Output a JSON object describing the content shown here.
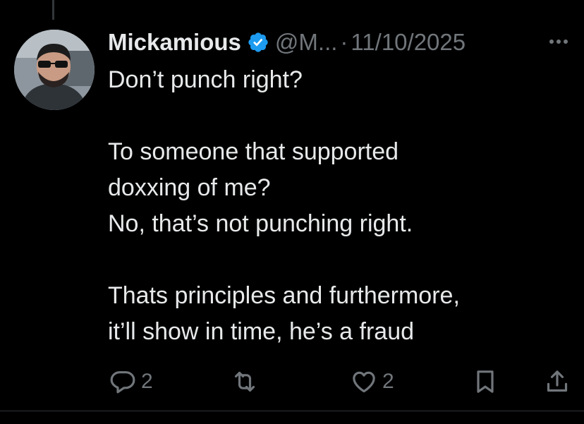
{
  "tweet": {
    "display_name": "Mickamious",
    "handle": "@M...",
    "separator": "·",
    "date": "11/10/2025",
    "verified": true,
    "lines": [
      "Don’t punch right?",
      "",
      "To someone that supported",
      "doxxing of me?",
      "No, that’s not punching right.",
      "",
      "Thats principles and furthermore,",
      "it’ll show in time, he’s a fraud"
    ]
  },
  "actions": {
    "reply_count": "2",
    "repost_count": "",
    "like_count": "2"
  },
  "icons": {
    "verified": "verified-badge-icon",
    "more": "more-icon",
    "reply": "reply-icon",
    "repost": "repost-icon",
    "like": "heart-icon",
    "bookmark": "bookmark-icon",
    "share": "share-icon"
  },
  "colors": {
    "background": "#000000",
    "text": "#e7e9ea",
    "muted": "#71767b",
    "verified": "#1d9bf0"
  }
}
